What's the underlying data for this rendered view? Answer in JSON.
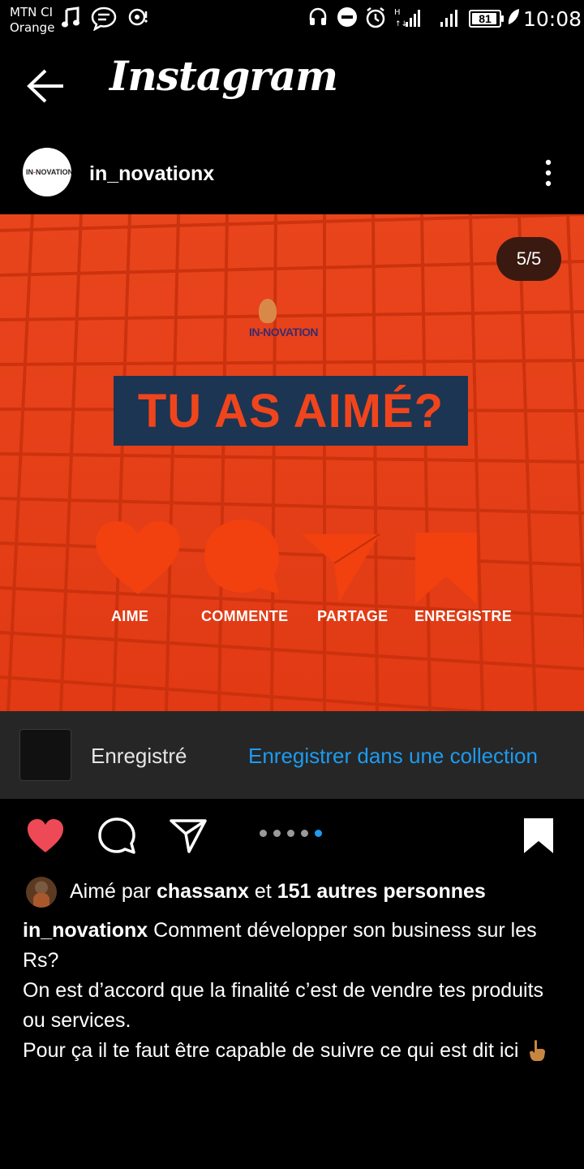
{
  "status_bar": {
    "carrier_line1": "MTN CI",
    "carrier_line2": "Orange",
    "battery": "81",
    "time": "10:08",
    "icons": [
      "music-note-icon",
      "message-icon",
      "hotspot-icon",
      "headphones-icon",
      "do-not-disturb-icon",
      "alarm-icon",
      "signal-h-icon",
      "signal-icon",
      "battery-icon",
      "leaf-icon"
    ]
  },
  "header": {
    "back_icon": "back-arrow-icon",
    "title": "Instagram"
  },
  "post": {
    "username": "in_novationx",
    "more_icon": "more-vertical-icon",
    "counter": "5/5",
    "image": {
      "brand": "IN-NOVATION",
      "headline": "TU AS AIMÉ?",
      "actions": [
        "AIME",
        "COMMENTE",
        "PARTAGE",
        "ENREGISTRE"
      ],
      "accent": "#f0451c",
      "box_color": "#1c3552"
    },
    "saved_label": "Enregistré",
    "collection_link": "Enregistrer dans une collection",
    "carousel": {
      "total": 5,
      "current": 5
    },
    "likes": {
      "prefix": "Aimé par",
      "user": "chassanx",
      "middle": "et",
      "others": "151 autres personnes"
    },
    "caption": {
      "username": "in_novationx",
      "line1": "Comment développer son business sur les Rs?",
      "line2": "On est d’accord que la finalité c’est de vendre tes produits ou services.",
      "line3": "Pour ça il te faut être capable de suivre ce qui est dit ici"
    }
  },
  "colors": {
    "like_red": "#ed4956",
    "link_blue": "#1c9bf0",
    "background": "#000000"
  }
}
